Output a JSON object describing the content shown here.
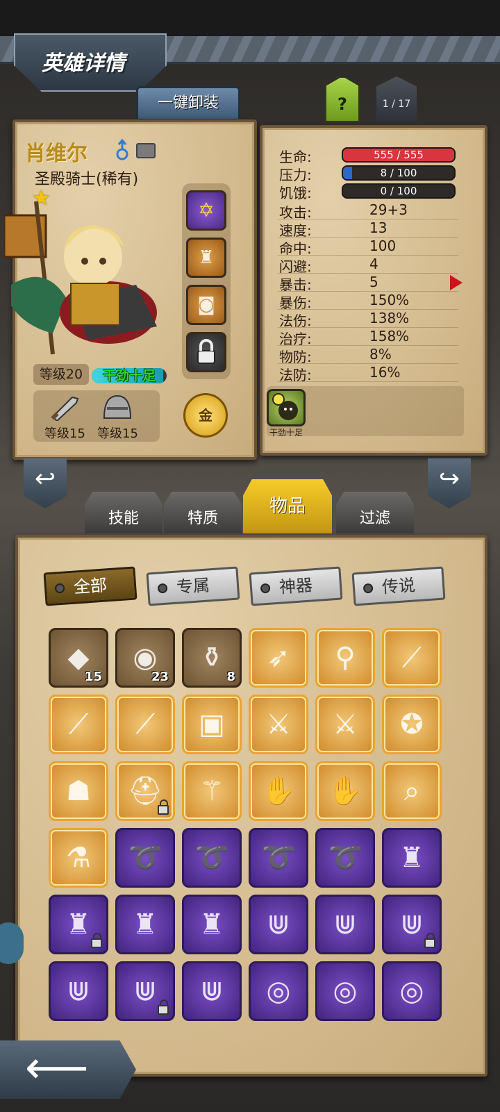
{
  "header": {
    "title": "英雄详情"
  },
  "buttons": {
    "unequip": "一键卸装",
    "help": "?",
    "page_indicator": "1 / 17"
  },
  "hero": {
    "name": "肖维尔",
    "class": "圣殿骑士(稀有)",
    "level": "等级20",
    "mood": "干劲十足",
    "mood_fraction": 0.95,
    "weapon_level": "等级15",
    "armor_level": "等级15",
    "gold_button": "金"
  },
  "stats": {
    "hp": {
      "label": "生命:",
      "value": "555 / 555",
      "fraction": 1.0,
      "color": "#d9353f"
    },
    "stress": {
      "label": "压力:",
      "value": "8 / 100",
      "fraction": 0.08,
      "color": "#2d67c8"
    },
    "hunger": {
      "label": "饥饿:",
      "value": "0 / 100",
      "fraction": 0.0,
      "color": "#d08a2a"
    },
    "attack": {
      "label": "攻击:",
      "value": "29+3"
    },
    "speed": {
      "label": "速度:",
      "value": "13"
    },
    "accuracy": {
      "label": "命中:",
      "value": "100"
    },
    "dodge": {
      "label": "闪避:",
      "value": "4"
    },
    "crit": {
      "label": "暴击:",
      "value": "5"
    },
    "crit_damage": {
      "label": "暴伤:",
      "value": "150%"
    },
    "magic_damage": {
      "label": "法伤:",
      "value": "138%"
    },
    "healing": {
      "label": "治疗:",
      "value": "158%"
    },
    "phys_def": {
      "label": "物防:",
      "value": "8%"
    },
    "magic_def": {
      "label": "法防:",
      "value": "16%"
    }
  },
  "trait": {
    "label": "干劲十足"
  },
  "tabs": [
    {
      "label": "技能",
      "active": false
    },
    {
      "label": "特质",
      "active": false
    },
    {
      "label": "物品",
      "active": true
    },
    {
      "label": "过滤",
      "active": false
    }
  ],
  "filters": [
    {
      "label": "全部",
      "active": true
    },
    {
      "label": "专属",
      "active": false
    },
    {
      "label": "神器",
      "active": false
    },
    {
      "label": "传说",
      "active": false
    }
  ],
  "inventory": [
    [
      {
        "icon": "gem-icon",
        "rarity": "brown",
        "count": "15",
        "locked": false
      },
      {
        "icon": "rune-stone-icon",
        "rarity": "brown",
        "count": "23",
        "locked": false
      },
      {
        "icon": "potion-icon",
        "rarity": "brown",
        "count": "8",
        "locked": false
      },
      {
        "icon": "crossbow-icon",
        "rarity": "gold",
        "count": "",
        "locked": false
      },
      {
        "icon": "staff-icon",
        "rarity": "gold",
        "count": "",
        "locked": false
      },
      {
        "icon": "katana-icon",
        "rarity": "gold",
        "count": "",
        "locked": false
      }
    ],
    [
      {
        "icon": "katana-icon",
        "rarity": "gold",
        "count": "",
        "locked": false
      },
      {
        "icon": "katana-icon",
        "rarity": "gold",
        "count": "",
        "locked": false
      },
      {
        "icon": "spellbook-icon",
        "rarity": "gold",
        "count": "",
        "locked": false
      },
      {
        "icon": "rapier-icon",
        "rarity": "gold",
        "count": "",
        "locked": false
      },
      {
        "icon": "sword-icon",
        "rarity": "gold",
        "count": "",
        "locked": false
      },
      {
        "icon": "winged-amulet-icon",
        "rarity": "gold",
        "count": "",
        "locked": false
      }
    ],
    [
      {
        "icon": "hood-icon",
        "rarity": "gold",
        "count": "",
        "locked": false
      },
      {
        "icon": "helmet-icon",
        "rarity": "gold",
        "count": "",
        "locked": true
      },
      {
        "icon": "scepter-icon",
        "rarity": "gold",
        "count": "",
        "locked": false
      },
      {
        "icon": "gauntlet-icon",
        "rarity": "gold",
        "count": "",
        "locked": false
      },
      {
        "icon": "gauntlet-icon",
        "rarity": "gold",
        "count": "",
        "locked": false
      },
      {
        "icon": "spyglass-icon",
        "rarity": "gold",
        "count": "",
        "locked": false
      }
    ],
    [
      {
        "icon": "bottle-icon",
        "rarity": "gold",
        "count": "",
        "locked": false
      },
      {
        "icon": "whip-icon",
        "rarity": "purple",
        "count": "",
        "locked": false
      },
      {
        "icon": "whip-icon",
        "rarity": "purple",
        "count": "",
        "locked": false
      },
      {
        "icon": "whip-icon",
        "rarity": "purple",
        "count": "",
        "locked": false
      },
      {
        "icon": "whip-icon",
        "rarity": "purple",
        "count": "",
        "locked": false
      },
      {
        "icon": "armor-icon",
        "rarity": "purple",
        "count": "",
        "locked": false
      }
    ],
    [
      {
        "icon": "armor-icon",
        "rarity": "purple",
        "count": "",
        "locked": true
      },
      {
        "icon": "armor-icon",
        "rarity": "purple",
        "count": "",
        "locked": false
      },
      {
        "icon": "armor-icon",
        "rarity": "purple",
        "count": "",
        "locked": false
      },
      {
        "icon": "claw-necklace-icon",
        "rarity": "purple",
        "count": "",
        "locked": false
      },
      {
        "icon": "claw-necklace-icon",
        "rarity": "purple",
        "count": "",
        "locked": false
      },
      {
        "icon": "claw-necklace-icon",
        "rarity": "purple",
        "count": "",
        "locked": true
      }
    ],
    [
      {
        "icon": "claw-necklace-icon",
        "rarity": "purple",
        "count": "",
        "locked": false
      },
      {
        "icon": "claw-necklace-icon",
        "rarity": "purple",
        "count": "",
        "locked": true
      },
      {
        "icon": "claw-necklace-icon",
        "rarity": "purple",
        "count": "",
        "locked": false
      },
      {
        "icon": "red-collar-icon",
        "rarity": "purple",
        "count": "",
        "locked": false
      },
      {
        "icon": "red-collar-icon",
        "rarity": "purple",
        "count": "",
        "locked": false
      },
      {
        "icon": "red-collar-icon",
        "rarity": "purple",
        "count": "",
        "locked": false
      }
    ]
  ]
}
